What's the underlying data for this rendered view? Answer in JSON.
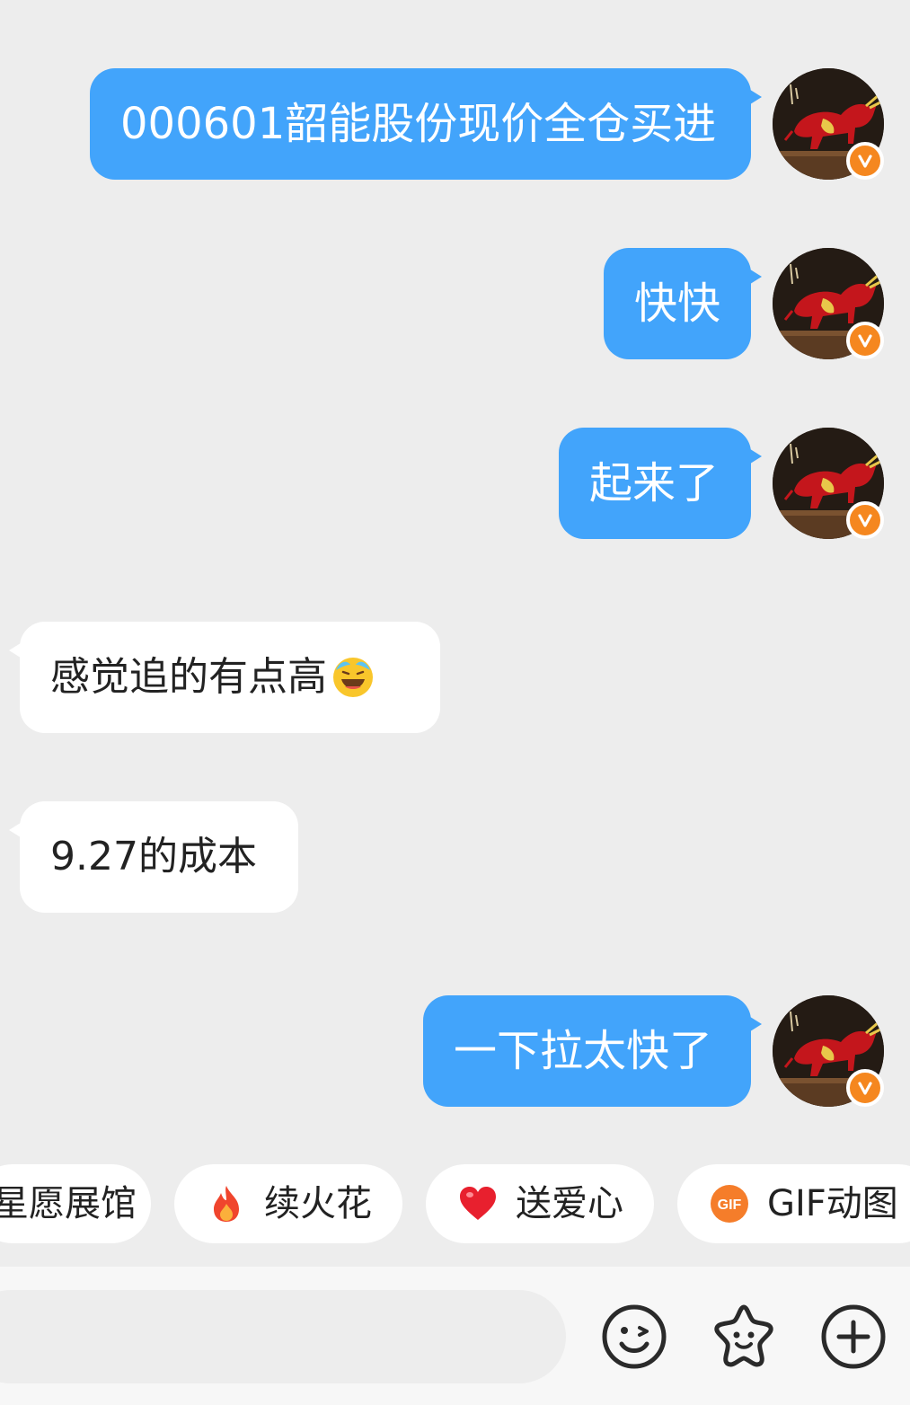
{
  "messages": [
    {
      "side": "out",
      "text": "000601韶能股份现价全仓买进"
    },
    {
      "side": "out",
      "text": "快快"
    },
    {
      "side": "out",
      "text": "起来了"
    },
    {
      "side": "in",
      "text": "感觉追的有点高",
      "emoji": "laughing-tears-emoji"
    },
    {
      "side": "in",
      "text": "9.27的成本"
    },
    {
      "side": "out",
      "text": "一下拉太快了"
    }
  ],
  "avatar": {
    "badge": "V",
    "badge_color": "#f5871f"
  },
  "quick_actions": [
    {
      "label": "星愿展馆",
      "icon": ""
    },
    {
      "label": "续火花",
      "icon": "fire-icon"
    },
    {
      "label": "送爱心",
      "icon": "heart-icon"
    },
    {
      "label": "GIF动图",
      "icon": "gif-icon",
      "icon_text": "GIF"
    }
  ],
  "input": {
    "placeholder": ""
  },
  "toolbar": {
    "icons": [
      "emoji-icon",
      "sticker-icon",
      "plus-icon"
    ]
  },
  "colors": {
    "outgoing_bubble": "#42a4fb",
    "incoming_bubble": "#ffffff",
    "background": "#ededed"
  }
}
